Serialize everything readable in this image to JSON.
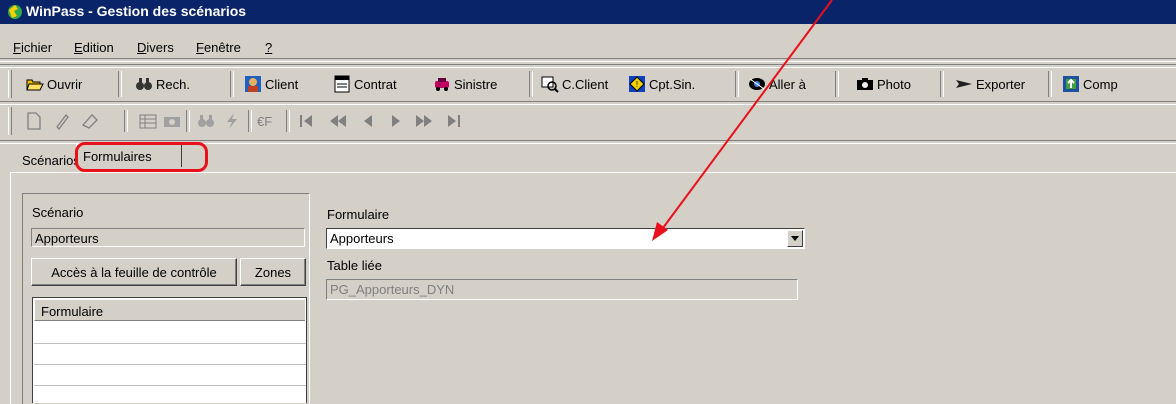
{
  "window": {
    "title": "WinPass - Gestion des scénarios",
    "app_icon": "winpass-logo-icon"
  },
  "menu": [
    {
      "label": "Fichier",
      "underline": "F",
      "rest": "ichier"
    },
    {
      "label": "Edition",
      "underline": "E",
      "rest": "dition"
    },
    {
      "label": "Divers",
      "underline": "D",
      "rest": "ivers"
    },
    {
      "label": "Fenêtre",
      "underline": "F",
      "rest": "enêtre"
    },
    {
      "label": "?",
      "underline": "?",
      "rest": ""
    }
  ],
  "toolbar": {
    "open": "Ouvrir",
    "search": "Rech.",
    "client": "Client",
    "contract": "Contrat",
    "claim": "Sinistre",
    "c_client": "C.Client",
    "cpt_sin": "Cpt.Sin.",
    "goto": "Aller à",
    "photo": "Photo",
    "export": "Exporter",
    "comp": "Comp"
  },
  "toolbar2_icons": [
    "new-page-icon",
    "pencil-icon",
    "eraser-icon",
    "list-icon",
    "camera-icon",
    "binoculars-icon",
    "lightning-icon",
    "euro-icon",
    "first-record-icon",
    "previous-page-icon",
    "previous-record-icon",
    "next-record-icon",
    "next-page-icon",
    "last-record-icon"
  ],
  "tabs": {
    "scenarios": "Scénarios",
    "formulaires": "Formulaires"
  },
  "left": {
    "scenario_label": "Scénario",
    "scenario_value": "Apporteurs",
    "access_button": "Accès à la feuille de contrôle",
    "zones_button": "Zones",
    "list_header": "Formulaire"
  },
  "right": {
    "formulaire_label": "Formulaire",
    "formulaire_value": "Apporteurs",
    "table_label": "Table liée",
    "table_value": "PG_Apporteurs_DYN"
  },
  "colors": {
    "titlebar": "#0a246a",
    "annotation": "#e8101a",
    "window_bg": "#d4d0c8"
  }
}
